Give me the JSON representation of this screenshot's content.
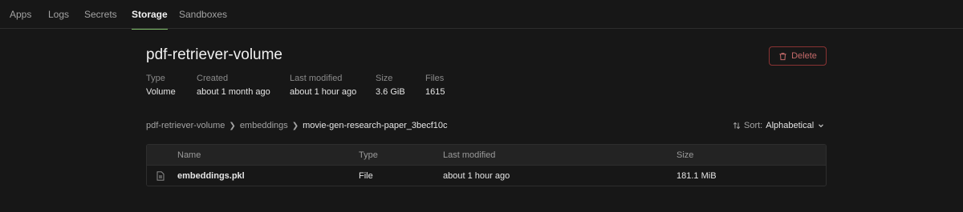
{
  "nav": {
    "tabs": [
      {
        "label": "Apps"
      },
      {
        "label": "Logs"
      },
      {
        "label": "Secrets"
      },
      {
        "label": "Storage"
      },
      {
        "label": "Sandboxes"
      }
    ],
    "active": "Storage"
  },
  "volume": {
    "title": "pdf-retriever-volume",
    "delete_label": "Delete",
    "meta": [
      {
        "label": "Type",
        "value": "Volume"
      },
      {
        "label": "Created",
        "value": "about 1 month ago"
      },
      {
        "label": "Last modified",
        "value": "about 1 hour ago"
      },
      {
        "label": "Size",
        "value": "3.6 GiB"
      },
      {
        "label": "Files",
        "value": "1615"
      }
    ]
  },
  "breadcrumb": [
    {
      "label": "pdf-retriever-volume"
    },
    {
      "label": "embeddings"
    },
    {
      "label": "movie-gen-research-paper_3becf10c"
    }
  ],
  "sort": {
    "label": "Sort:",
    "value": "Alphabetical"
  },
  "table": {
    "columns": [
      "Name",
      "Type",
      "Last modified",
      "Size"
    ],
    "rows": [
      {
        "icon": "file-icon",
        "name": "embeddings.pkl",
        "type": "File",
        "modified": "about 1 hour ago",
        "size": "181.1 MiB"
      }
    ]
  },
  "colors": {
    "background": "#171717",
    "active_tab_underline": "#7fbf6a",
    "danger": "#c46a6a"
  }
}
